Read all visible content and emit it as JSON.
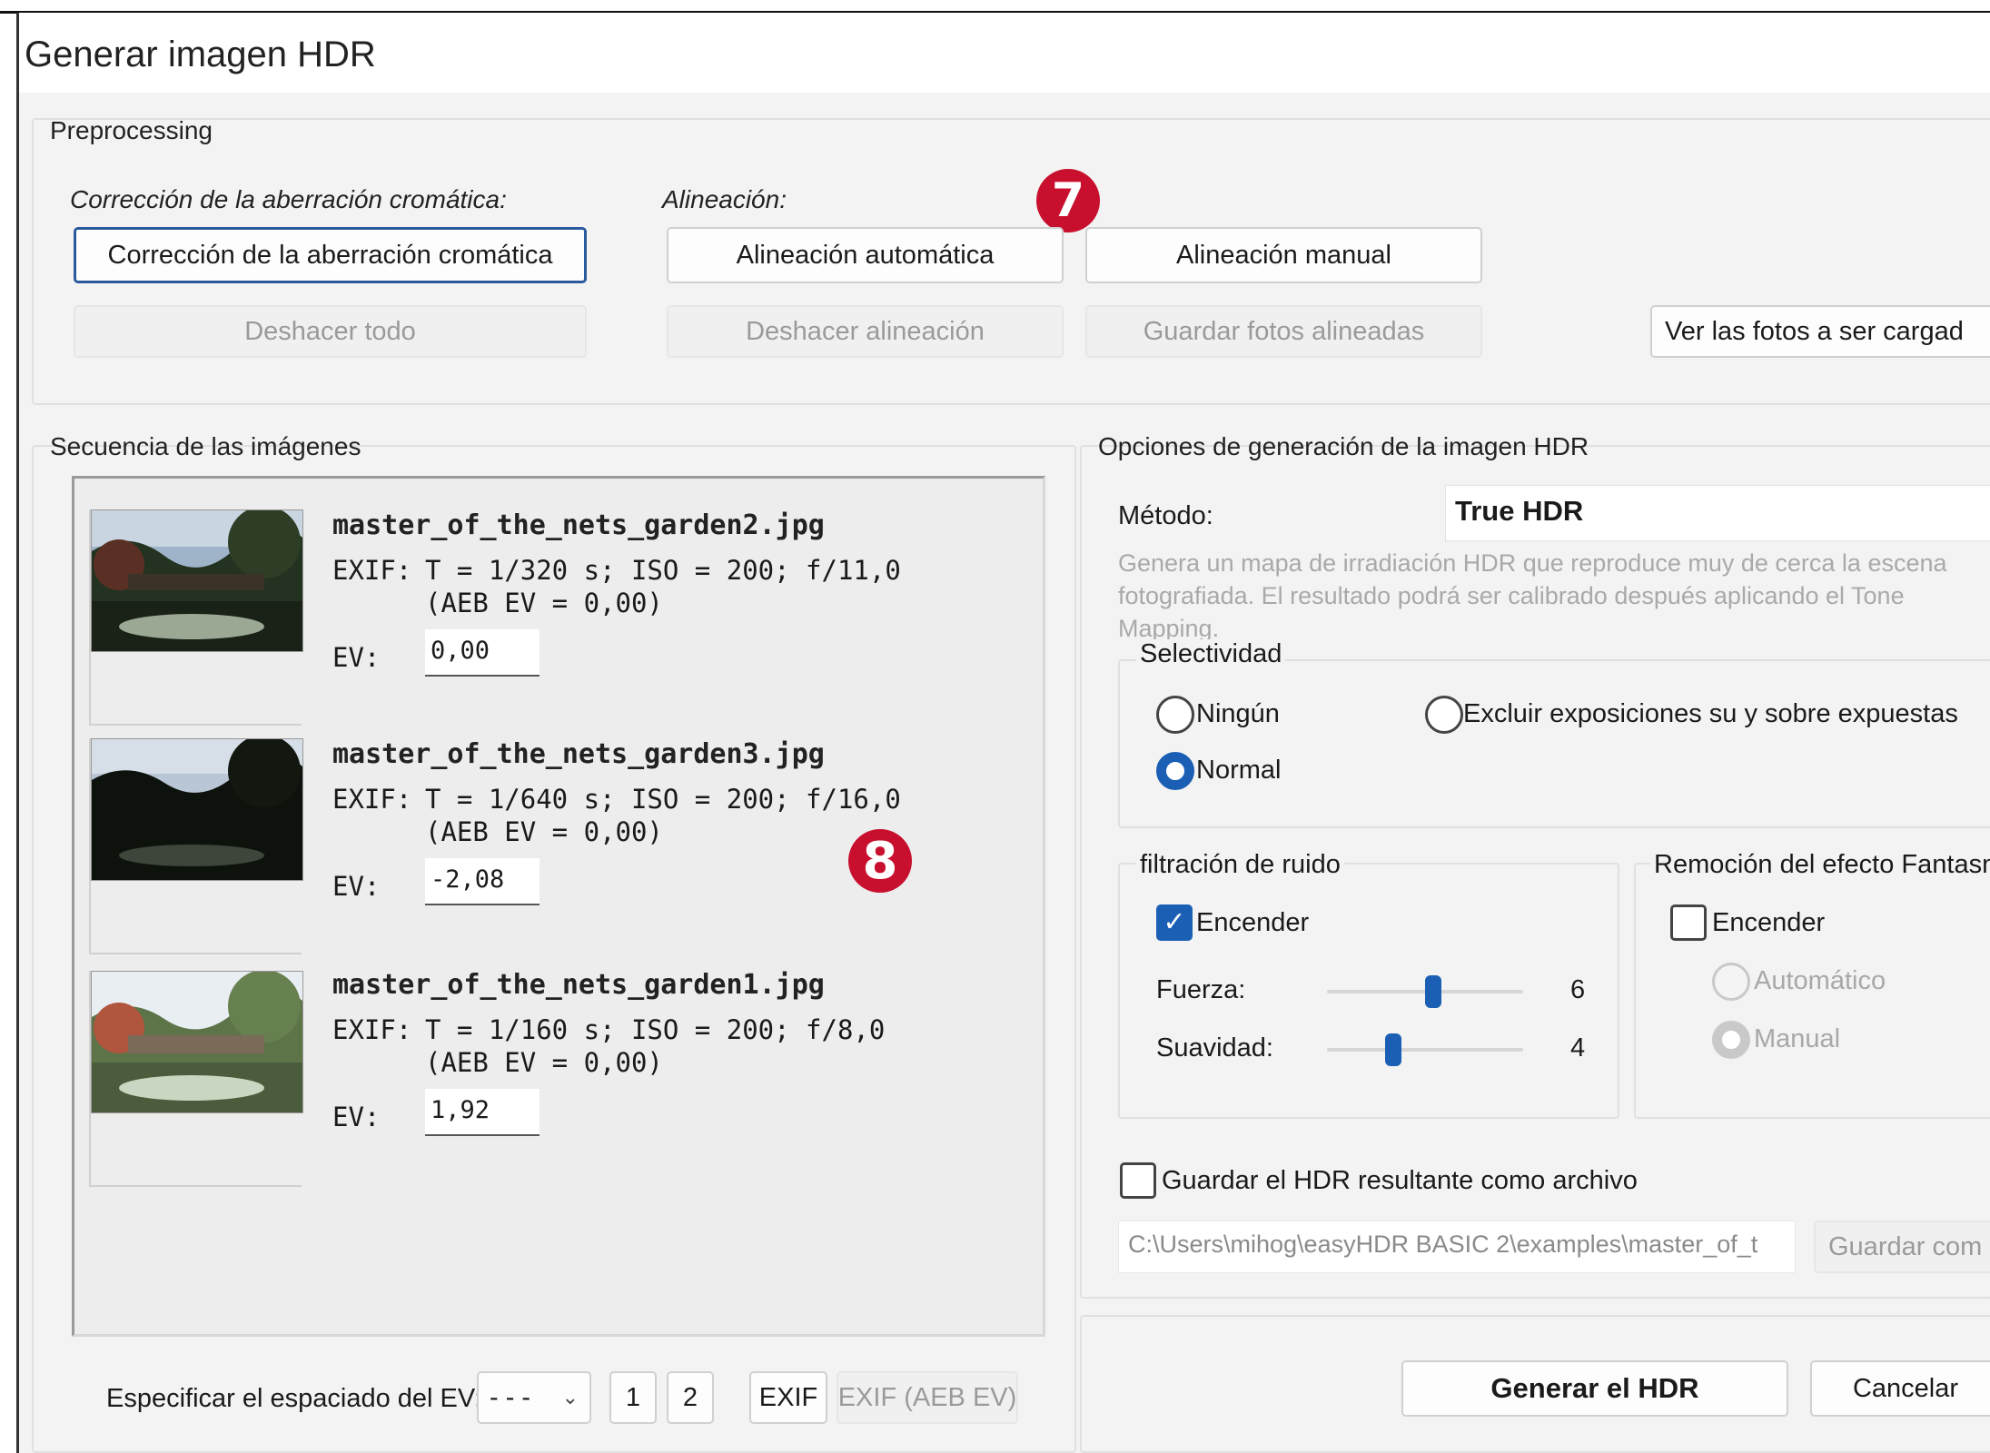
{
  "window": {
    "title": "Generar imagen HDR"
  },
  "markers": {
    "seven": "7",
    "eight": "8"
  },
  "preprocessing": {
    "group_label": "Preprocessing",
    "chromatic_label": "Corrección de la aberración cromática:",
    "alignment_label": "Alineación:",
    "btn_chromatic": "Corrección de la aberración cromática",
    "btn_auto_align": "Alineación automática",
    "btn_manual_align": "Alineación manual",
    "btn_undo_all": "Deshacer todo",
    "btn_undo_align": "Deshacer alineación",
    "btn_save_aligned": "Guardar fotos alineadas",
    "btn_view_photos": "Ver las fotos  a ser cargad"
  },
  "sequence": {
    "group_label": "Secuencia de las imágenes",
    "images": [
      {
        "filename": "master_of_the_nets_garden2.jpg",
        "exif_label": "EXIF:",
        "exif": "T = 1/320 s; ISO = 200; f/11,0",
        "aeb": "(AEB EV = 0,00)",
        "ev_label": "EV:",
        "ev": "0,00"
      },
      {
        "filename": "master_of_the_nets_garden3.jpg",
        "exif_label": "EXIF:",
        "exif": "T = 1/640 s; ISO = 200; f/16,0",
        "aeb": "(AEB EV = 0,00)",
        "ev_label": "EV:",
        "ev": "-2,08"
      },
      {
        "filename": "master_of_the_nets_garden1.jpg",
        "exif_label": "EXIF:",
        "exif": "T = 1/160 s; ISO = 200; f/8,0",
        "aeb": "(AEB EV = 0,00)",
        "ev_label": "EV:",
        "ev": "1,92"
      }
    ],
    "ev_spacing_label": "Especificar el espaciado del EV:",
    "ev_spacing_value": "- - -",
    "btn_1": "1",
    "btn_2": "2",
    "btn_exif": "EXIF",
    "btn_exif_aeb": "EXIF (AEB EV)"
  },
  "options": {
    "group_label": "Opciones de generación de la imagen HDR",
    "method_label": "Método:",
    "method_value": "True HDR",
    "description": "Genera un mapa de irradiación HDR que reproduce muy de cerca la escena fotografiada. El resultado podrá ser calibrado después aplicando el Tone Mapping.",
    "selectivity": {
      "label": "Selectividad",
      "opt_none": "Ningún",
      "opt_exclude": "Excluir exposiciones su y sobre expuestas",
      "opt_normal": "Normal"
    },
    "noise": {
      "label": "filtración de ruido",
      "enable": "Encender",
      "strength_label": "Fuerza:",
      "strength_value": "6",
      "smooth_label": "Suavidad:",
      "smooth_value": "4"
    },
    "ghost": {
      "label": "Remoción del efecto Fantasn",
      "enable": "Encender",
      "opt_auto": "Automático",
      "opt_manual": "Manual"
    },
    "save_label": "Guardar el HDR resultante como archivo",
    "save_path": "C:\\Users\\mihog\\easyHDR BASIC 2\\examples\\master_of_t",
    "btn_save_as": "Guardar com"
  },
  "footer": {
    "btn_generate": "Generar el HDR",
    "btn_cancel": "Cancelar"
  }
}
